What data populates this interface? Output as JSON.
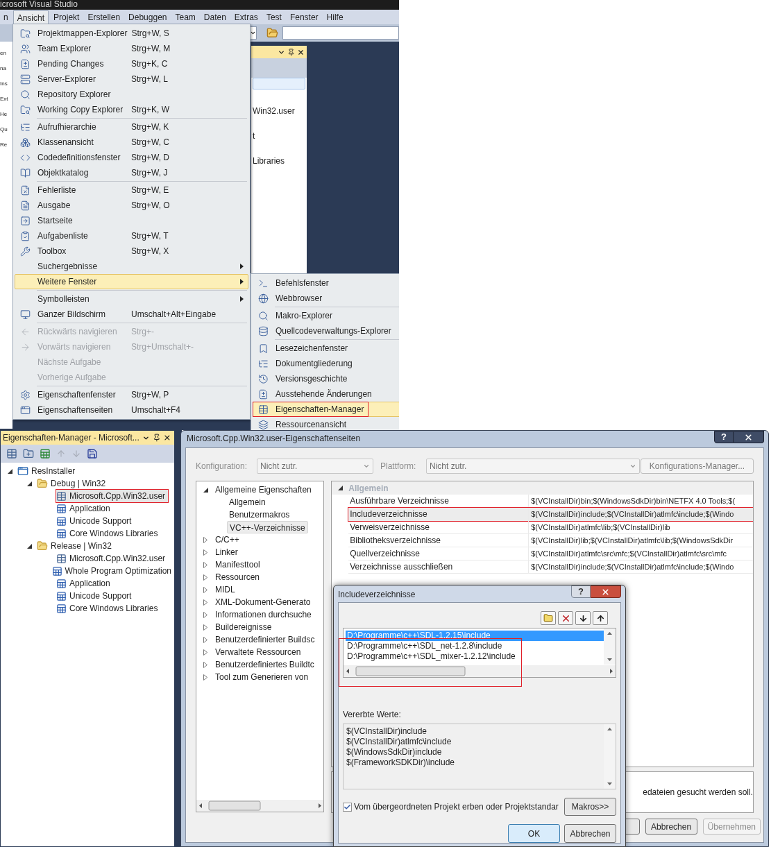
{
  "vs_window": {
    "title": "icrosoft Visual Studio",
    "menu_bar": [
      {
        "label": "n",
        "selected": false
      },
      {
        "label": "Ansicht",
        "selected": true
      },
      {
        "label": "Projekt",
        "selected": false
      },
      {
        "label": "Erstellen",
        "selected": false
      },
      {
        "label": "Debuggen",
        "selected": false
      },
      {
        "label": "Team",
        "selected": false
      },
      {
        "label": "Daten",
        "selected": false
      },
      {
        "label": "Extras",
        "selected": false
      },
      {
        "label": "Test",
        "selected": false
      },
      {
        "label": "Fenster",
        "selected": false
      },
      {
        "label": "Hilfe",
        "selected": false
      }
    ],
    "side_fragments": [
      "en",
      "na",
      "Ins",
      "Ext",
      "He",
      "Qu",
      "Re"
    ],
    "background_texts": [
      "Win32.user",
      "t",
      "Libraries"
    ],
    "view_menu": [
      {
        "kind": "item",
        "label": "Projektmappen-Explorer",
        "shortcut": "Strg+W, S",
        "icon": true,
        "disabled": false,
        "selected": false,
        "submenu": false,
        "annotated": false
      },
      {
        "kind": "item",
        "label": "Team Explorer",
        "shortcut": "Strg+W, M",
        "icon": true,
        "disabled": false,
        "selected": false,
        "submenu": false,
        "annotated": false
      },
      {
        "kind": "item",
        "label": "Pending Changes",
        "shortcut": "Strg+K, C",
        "icon": true,
        "disabled": false,
        "selected": false,
        "submenu": false,
        "annotated": false
      },
      {
        "kind": "item",
        "label": "Server-Explorer",
        "shortcut": "Strg+W, L",
        "icon": true,
        "disabled": false,
        "selected": false,
        "submenu": false,
        "annotated": false
      },
      {
        "kind": "item",
        "label": "Repository Explorer",
        "icon": true,
        "disabled": false,
        "selected": false,
        "submenu": false,
        "annotated": false
      },
      {
        "kind": "item",
        "label": "Working Copy Explorer",
        "shortcut": "Strg+K, W",
        "icon": true,
        "disabled": false,
        "selected": false,
        "submenu": false,
        "annotated": false
      },
      {
        "kind": "separator"
      },
      {
        "kind": "item",
        "label": "Aufrufhierarchie",
        "shortcut": "Strg+W, K",
        "icon": true,
        "disabled": false,
        "selected": false,
        "submenu": false,
        "annotated": false
      },
      {
        "kind": "item",
        "label": "Klassenansicht",
        "shortcut": "Strg+W, C",
        "icon": true,
        "disabled": false,
        "selected": false,
        "submenu": false,
        "annotated": false
      },
      {
        "kind": "item",
        "label": "Codedefinitionsfenster",
        "shortcut": "Strg+W, D",
        "icon": true,
        "disabled": false,
        "selected": false,
        "submenu": false,
        "annotated": false
      },
      {
        "kind": "item",
        "label": "Objektkatalog",
        "shortcut": "Strg+W, J",
        "icon": true,
        "disabled": false,
        "selected": false,
        "submenu": false,
        "annotated": false
      },
      {
        "kind": "separator"
      },
      {
        "kind": "item",
        "label": "Fehlerliste",
        "shortcut": "Strg+W, E",
        "icon": true,
        "disabled": false,
        "selected": false,
        "submenu": false,
        "annotated": false
      },
      {
        "kind": "item",
        "label": "Ausgabe",
        "shortcut": "Strg+W, O",
        "icon": true,
        "disabled": false,
        "selected": false,
        "submenu": false,
        "annotated": false
      },
      {
        "kind": "item",
        "label": "Startseite",
        "icon": true,
        "disabled": false,
        "selected": false,
        "submenu": false,
        "annotated": false
      },
      {
        "kind": "item",
        "label": "Aufgabenliste",
        "shortcut": "Strg+W, T",
        "icon": true,
        "disabled": false,
        "selected": false,
        "submenu": false,
        "annotated": false
      },
      {
        "kind": "item",
        "label": "Toolbox",
        "shortcut": "Strg+W, X",
        "icon": true,
        "disabled": false,
        "selected": false,
        "submenu": false,
        "annotated": false
      },
      {
        "kind": "item",
        "label": "Suchergebnisse",
        "icon": false,
        "disabled": false,
        "selected": false,
        "submenu": true,
        "annotated": false
      },
      {
        "kind": "item",
        "label": "Weitere Fenster",
        "icon": false,
        "disabled": false,
        "selected": true,
        "submenu": true,
        "annotated": false
      },
      {
        "kind": "separator"
      },
      {
        "kind": "item",
        "label": "Symbolleisten",
        "icon": false,
        "disabled": false,
        "selected": false,
        "submenu": true,
        "annotated": false
      },
      {
        "kind": "item",
        "label": "Ganzer Bildschirm",
        "shortcut": "Umschalt+Alt+Eingabe",
        "icon": true,
        "disabled": false,
        "selected": false,
        "submenu": false,
        "annotated": false
      },
      {
        "kind": "separator"
      },
      {
        "kind": "item",
        "label": "Rückwärts navigieren",
        "shortcut": "Strg+-",
        "icon": true,
        "disabled": true,
        "selected": false,
        "submenu": false,
        "annotated": false
      },
      {
        "kind": "item",
        "label": "Vorwärts navigieren",
        "shortcut": "Strg+Umschalt+-",
        "icon": true,
        "disabled": true,
        "selected": false,
        "submenu": false,
        "annotated": false
      },
      {
        "kind": "item",
        "label": "Nächste Aufgabe",
        "icon": false,
        "disabled": true,
        "selected": false,
        "submenu": false,
        "annotated": false
      },
      {
        "kind": "item",
        "label": "Vorherige Aufgabe",
        "icon": false,
        "disabled": true,
        "selected": false,
        "submenu": false,
        "annotated": false
      },
      {
        "kind": "separator"
      },
      {
        "kind": "item",
        "label": "Eigenschaftenfenster",
        "shortcut": "Strg+W, P",
        "icon": true,
        "disabled": false,
        "selected": false,
        "submenu": false,
        "annotated": false
      },
      {
        "kind": "item",
        "label": "Eigenschaftenseiten",
        "shortcut": "Umschalt+F4",
        "icon": true,
        "disabled": false,
        "selected": false,
        "submenu": false,
        "annotated": false
      }
    ],
    "more_windows_menu": [
      {
        "kind": "item",
        "label": "Befehlsfenster",
        "icon": true,
        "disabled": false,
        "selected": false,
        "annotated": false
      },
      {
        "kind": "item",
        "label": "Webbrowser",
        "icon": true,
        "disabled": false,
        "selected": false,
        "annotated": false
      },
      {
        "kind": "separator"
      },
      {
        "kind": "item",
        "label": "Makro-Explorer",
        "icon": true,
        "disabled": false,
        "selected": false,
        "annotated": false
      },
      {
        "kind": "item",
        "label": "Quellcodeverwaltungs-Explorer",
        "icon": true,
        "disabled": false,
        "selected": false,
        "annotated": false
      },
      {
        "kind": "separator"
      },
      {
        "kind": "item",
        "label": "Lesezeichenfenster",
        "icon": true,
        "disabled": false,
        "selected": false,
        "annotated": false
      },
      {
        "kind": "item",
        "label": "Dokumentgliederung",
        "icon": true,
        "disabled": false,
        "selected": false,
        "annotated": false
      },
      {
        "kind": "item",
        "label": "Versionsgeschichte",
        "icon": true,
        "disabled": false,
        "selected": false,
        "annotated": false
      },
      {
        "kind": "item",
        "label": "Ausstehende Änderungen",
        "icon": true,
        "disabled": false,
        "selected": false,
        "annotated": false
      },
      {
        "kind": "item",
        "label": "Eigenschaften-Manager",
        "icon": true,
        "disabled": false,
        "selected": true,
        "annotated": true
      },
      {
        "kind": "item",
        "label": "Ressourcenansicht",
        "icon": true,
        "disabled": false,
        "selected": false,
        "annotated": false
      }
    ]
  },
  "property_manager": {
    "title": "Eigenschaften-Manager - Microsoft...",
    "tree": [
      {
        "label": "ResInstaller",
        "kind": "project",
        "expanded": true,
        "selected": false,
        "annotated": false,
        "children": [
          {
            "label": "Debug | Win32",
            "kind": "folder",
            "expanded": true,
            "selected": false,
            "annotated": false,
            "children": [
              {
                "label": "Microsoft.Cpp.Win32.user",
                "kind": "user_sheet",
                "selected": true,
                "annotated": true
              },
              {
                "label": "Application",
                "kind": "sheet",
                "selected": false,
                "annotated": false
              },
              {
                "label": "Unicode Support",
                "kind": "sheet",
                "selected": false,
                "annotated": false
              },
              {
                "label": "Core Windows Libraries",
                "kind": "sheet",
                "selected": false,
                "annotated": false
              }
            ]
          },
          {
            "label": "Release | Win32",
            "kind": "folder",
            "expanded": true,
            "selected": false,
            "annotated": false,
            "children": [
              {
                "label": "Microsoft.Cpp.Win32.user",
                "kind": "user_sheet",
                "selected": false,
                "annotated": false
              },
              {
                "label": "Whole Program Optimization",
                "kind": "sheet",
                "selected": false,
                "annotated": false
              },
              {
                "label": "Application",
                "kind": "sheet",
                "selected": false,
                "annotated": false
              },
              {
                "label": "Unicode Support",
                "kind": "sheet",
                "selected": false,
                "annotated": false
              },
              {
                "label": "Core Windows Libraries",
                "kind": "sheet",
                "selected": false,
                "annotated": false
              }
            ]
          }
        ]
      }
    ]
  },
  "property_pages": {
    "title": "Microsoft.Cpp.Win32.user-Eigenschaftenseiten",
    "help_button": "?",
    "configuration": {
      "label": "Konfiguration:",
      "value": "Nicht zutr.",
      "disabled": true
    },
    "platform": {
      "label": "Plattform:",
      "value": "Nicht zutr.",
      "disabled": true
    },
    "config_manager_button": {
      "label": "Konfigurations-Manager...",
      "disabled": true
    },
    "tree": [
      {
        "label": "Allgemeine Eigenschaften",
        "expanded": true,
        "selected": false,
        "children": [
          {
            "label": "Allgemein",
            "selected": false
          },
          {
            "label": "Benutzermakros",
            "selected": false
          },
          {
            "label": "VC++-Verzeichnisse",
            "selected": true
          }
        ]
      },
      {
        "label": "C/C++",
        "expanded": false,
        "selected": false
      },
      {
        "label": "Linker",
        "expanded": false,
        "selected": false
      },
      {
        "label": "Manifesttool",
        "expanded": false,
        "selected": false
      },
      {
        "label": "Ressourcen",
        "expanded": false,
        "selected": false
      },
      {
        "label": "MIDL",
        "expanded": false,
        "selected": false
      },
      {
        "label": "XML-Dokument-Generato",
        "expanded": false,
        "selected": false
      },
      {
        "label": "Informationen durchsuche",
        "expanded": false,
        "selected": false
      },
      {
        "label": "Buildereignisse",
        "expanded": false,
        "selected": false
      },
      {
        "label": "Benutzerdefinierter Buildsc",
        "expanded": false,
        "selected": false
      },
      {
        "label": "Verwaltete Ressourcen",
        "expanded": false,
        "selected": false
      },
      {
        "label": "Benutzerdefiniertes Buildtc",
        "expanded": false,
        "selected": false
      },
      {
        "label": "Tool zum Generieren von",
        "expanded": false,
        "selected": false
      }
    ],
    "grid": {
      "category": "Allgemein",
      "category_expanded": true,
      "rows": [
        {
          "name": "Ausführbare Verzeichnisse",
          "value": "$(VCInstallDir)bin;$(WindowsSdkDir)bin\\NETFX 4.0 Tools;$(",
          "selected": false,
          "annotated": false
        },
        {
          "name": "Includeverzeichnisse",
          "value": "$(VCInstallDir)include;$(VCInstallDir)atlmfc\\include;$(Windo",
          "selected": true,
          "annotated": true
        },
        {
          "name": "Verweisverzeichnisse",
          "value": "$(VCInstallDir)atlmfc\\lib;$(VCInstallDir)lib",
          "selected": false,
          "annotated": false
        },
        {
          "name": "Bibliotheksverzeichnisse",
          "value": "$(VCInstallDir)lib;$(VCInstallDir)atlmfc\\lib;$(WindowsSdkDir",
          "selected": false,
          "annotated": false
        },
        {
          "name": "Quellverzeichnisse",
          "value": "$(VCInstallDir)atlmfc\\src\\mfc;$(VCInstallDir)atlmfc\\src\\mfc",
          "selected": false,
          "annotated": false
        },
        {
          "name": "Verzeichnisse ausschließen",
          "value": "$(VCInstallDir)include;$(VCInstallDir)atlmfc\\include;$(Windo",
          "selected": false,
          "annotated": false
        }
      ]
    },
    "description": "edateien gesucht werden soll.",
    "buttons": [
      {
        "label": "Abbrechen",
        "disabled": false
      },
      {
        "label": "Übernehmen",
        "disabled": true
      }
    ]
  },
  "include_dialog": {
    "title": "Includeverzeichnisse",
    "help_button": "?",
    "entries": [
      {
        "text": "D:\\Programme\\c++\\SDL-1.2.15\\include",
        "selected": true
      },
      {
        "text": "D:\\Programme\\c++\\SDL_net-1.2.8\\include",
        "selected": false
      },
      {
        "text": "D:\\Programme\\c++\\SDL_mixer-1.2.12\\include",
        "selected": false
      }
    ],
    "entries_annotated": true,
    "inherited_label": "Vererbte Werte:",
    "inherited": [
      "$(VCInstallDir)include",
      "$(VCInstallDir)atlmfc\\include",
      "$(WindowsSdkDir)include",
      "$(FrameworkSDKDir)\\include"
    ],
    "inherit_checkbox": {
      "label": "Vom übergeordneten Projekt erben oder Projektstandar",
      "checked": true
    },
    "macros_button": "Makros>>",
    "buttons": [
      {
        "label": "OK",
        "default": true
      },
      {
        "label": "Abbrechen",
        "default": false
      }
    ]
  }
}
